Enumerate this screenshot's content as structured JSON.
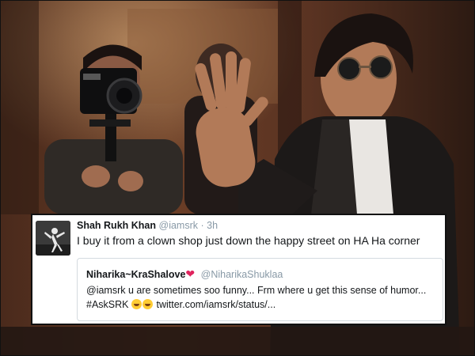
{
  "tweet": {
    "author_name": "Shah Rukh Khan",
    "author_handle": "@iamsrk",
    "separator": "·",
    "time": "3h",
    "text": "I buy it from a clown shop just down the happy street on HA Ha corner"
  },
  "quoted_tweet": {
    "author_name": "Niharika~KraShalove",
    "heart_glyph": "❤",
    "author_handle": "@NiharikaShuklaa",
    "text_before_emoji": "@iamsrk u are sometimes soo funny... Frm where u get this sense of humor... #AskSRK",
    "text_after_emoji": "twitter.com/iamsrk/status/..."
  },
  "colors": {
    "name_text": "#14171a",
    "meta_text": "#8899a6",
    "heart": "#e0245e",
    "quote_border": "#d4dbe0"
  },
  "icons": [
    "face-with-tears-of-joy-icon",
    "heart-icon"
  ]
}
